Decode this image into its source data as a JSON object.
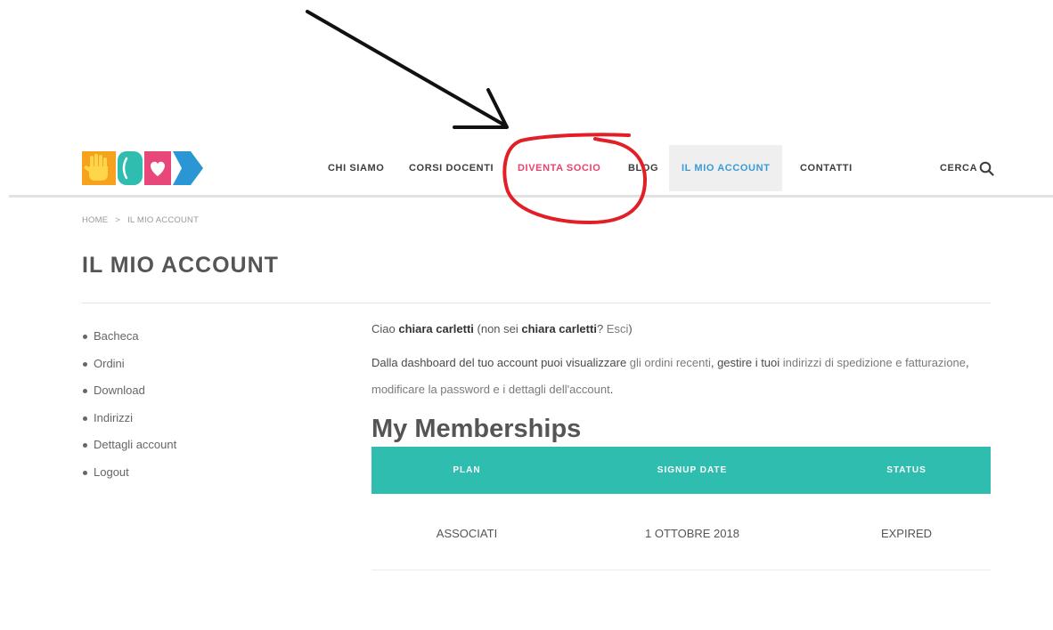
{
  "colors": {
    "teal": "#2fbdaf",
    "nav_highlight": "#e8436f",
    "nav_active": "#3a9ad6",
    "annotation_red": "#e21f26",
    "annotation_black": "#111111"
  },
  "header": {
    "logo_icon": "site-logo",
    "nav": [
      {
        "label": "CHI SIAMO"
      },
      {
        "label": "CORSI DOCENTI"
      },
      {
        "label": "DIVENTA SOCIO",
        "highlight": true
      },
      {
        "label": "BLOG"
      },
      {
        "label": "IL MIO ACCOUNT",
        "active": true
      },
      {
        "label": "CONTATTI"
      }
    ],
    "search_label": "CERCA",
    "search_icon": "search-icon"
  },
  "breadcrumb": {
    "home": "HOME",
    "separator": ">",
    "current": "IL MIO ACCOUNT"
  },
  "page_title": "IL MIO ACCOUNT",
  "sidebar": {
    "items": [
      "Bacheca",
      "Ordini",
      "Download",
      "Indirizzi",
      "Dettagli account",
      "Logout"
    ]
  },
  "greeting": {
    "hello": "Ciao ",
    "user_name": "chiara carletti",
    "not_you": " (non sei ",
    "question": "? ",
    "logout_link": "Esci",
    "close": ")"
  },
  "intro": {
    "text_1": "Dalla dashboard del tuo account puoi visualizzare ",
    "link_orders": "gli ordini recenti",
    "text_2": ", gestire i tuoi ",
    "link_addresses": "indirizzi di spedizione e fatturazione",
    "text_3": ",",
    "link_account": "modificare la password e i dettagli dell'account",
    "text_4": "."
  },
  "memberships": {
    "title": "My Memberships",
    "columns": [
      "PLAN",
      "SIGNUP DATE",
      "STATUS"
    ],
    "rows": [
      [
        "ASSOCIATI",
        "1 OTTOBRE 2018",
        "EXPIRED"
      ]
    ]
  }
}
